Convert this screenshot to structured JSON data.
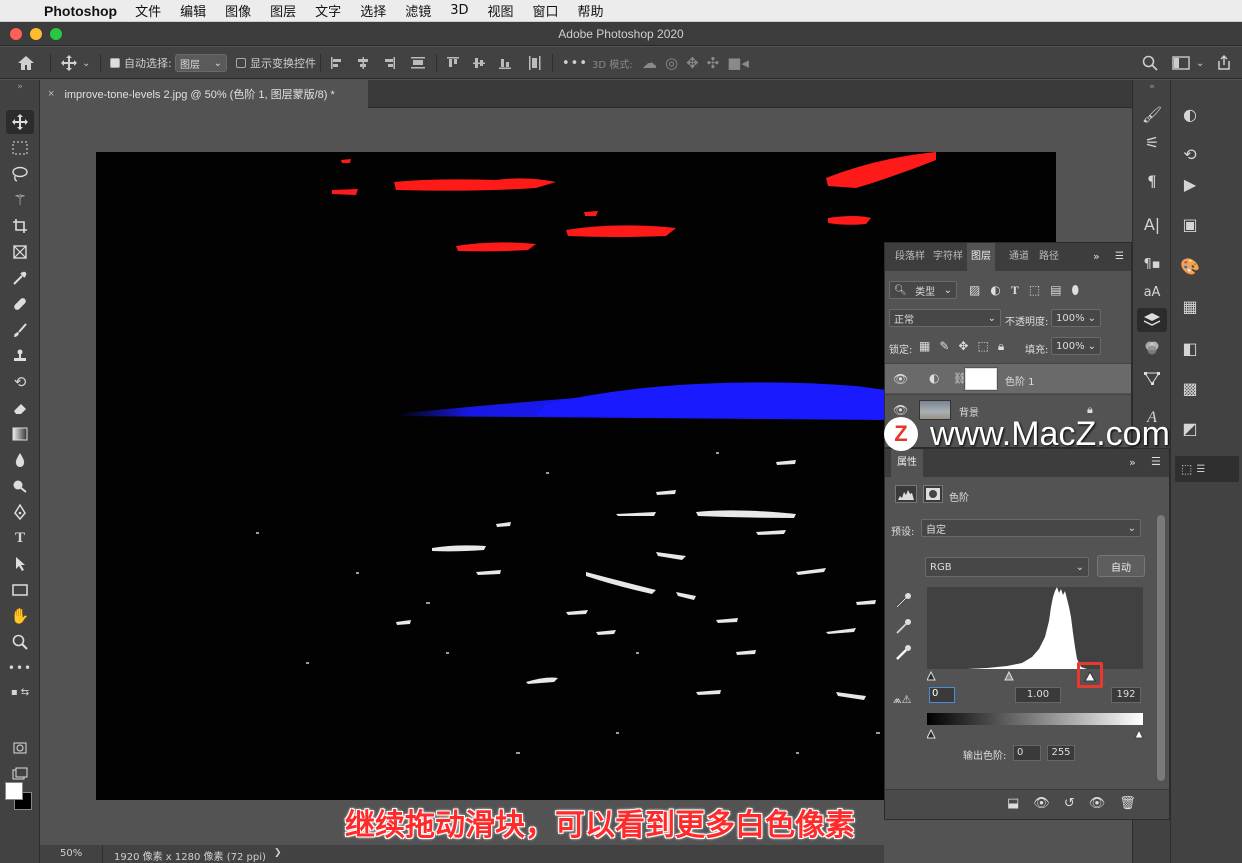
{
  "menubar": {
    "apple": "",
    "app": "Photoshop",
    "items": [
      "文件",
      "编辑",
      "图像",
      "图层",
      "文字",
      "选择",
      "滤镜",
      "3D",
      "视图",
      "窗口",
      "帮助"
    ]
  },
  "window": {
    "title": "Adobe Photoshop 2020"
  },
  "options": {
    "auto_select_label": "自动选择:",
    "auto_select_value": "图层",
    "show_transform_label": "显示变换控件",
    "mode_3d_label": "3D 模式:",
    "more": "•••"
  },
  "document": {
    "tab_title": "improve-tone-levels 2.jpg @ 50% (色阶 1, 图层蒙版/8) *",
    "close_glyph": "×"
  },
  "layers_panel": {
    "tabs": [
      "段落样",
      "字符样",
      "图层",
      "通道",
      "路径"
    ],
    "active_tab": "图层",
    "filter_kind": "类型",
    "blend_mode": "正常",
    "opacity_label": "不透明度:",
    "opacity_value": "100%",
    "lock_label": "锁定:",
    "fill_label": "填充:",
    "fill_value": "100%",
    "layers": [
      {
        "name": "色阶 1",
        "type": "adjustment",
        "selected": true
      },
      {
        "name": "背景",
        "type": "image",
        "locked": true
      }
    ]
  },
  "properties_panel": {
    "tab": "属性",
    "type_label": "色阶",
    "preset_label": "预设:",
    "preset_value": "自定",
    "channel_value": "RGB",
    "auto_button": "自动",
    "input_black": "0",
    "input_gamma": "1.00",
    "input_white": "192",
    "output_label": "输出色阶:",
    "output_black": "0",
    "output_white": "255",
    "white_slider_fraction": 0.753
  },
  "status": {
    "zoom": "50%",
    "doc_size": "1920 像素 x 1280 像素 (72 ppi)",
    "arrow": "❯"
  },
  "watermark": {
    "badge": "Z",
    "url": "www.MacZ.com"
  },
  "caption": "继续拖动滑块，可以看到更多白色像素",
  "colors": {
    "accent_red": "#e63a2e",
    "canvas_red": "#ff1a1a",
    "canvas_blue": "#1a1aff"
  }
}
